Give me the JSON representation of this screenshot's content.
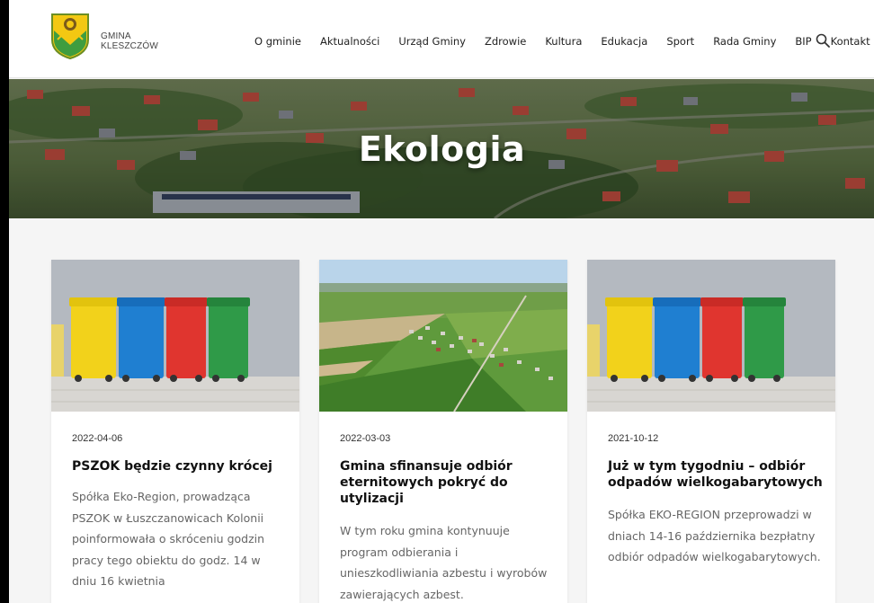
{
  "header": {
    "logo_line1": "GMINA",
    "logo_line2": "KLESZCZÓW",
    "nav": [
      "O gminie",
      "Aktualności",
      "Urząd Gminy",
      "Zdrowie",
      "Kultura",
      "Edukacja",
      "Sport",
      "Rada Gminy",
      "BIP",
      "Kontakt"
    ],
    "search_icon": "search-icon"
  },
  "hero": {
    "title": "Ekologia"
  },
  "cards": [
    {
      "date": "2022-04-06",
      "title": "PSZOK będzie czynny krócej",
      "excerpt": "Spółka Eko-Region, prowadząca PSZOK w Łuszczanowicach Kolonii poinformowała o skróceniu godzin pracy tego obiektu do godz. 14 w dniu 16 kwietnia"
    },
    {
      "date": "2022-03-03",
      "title": "Gmina sfinansuje odbiór eternitowych pokryć do utylizacji",
      "excerpt": "W tym roku gmina kontynuuje program odbierania i unieszkodliwiania azbestu i wyrobów zawierających azbest."
    },
    {
      "date": "2021-10-12",
      "title": "Już w tym tygodniu – odbiór odpadów wielkogabarytowych",
      "excerpt": "Spółka EKO-REGION przeprowadzi w dniach 14-16 października bezpłatny odbiór odpadów wielkogabarytowych."
    }
  ],
  "colors": {
    "bin_yellow": "#f2d21b",
    "bin_blue": "#1f7fd1",
    "bin_red": "#e0352f",
    "bin_green": "#2f9a48"
  }
}
